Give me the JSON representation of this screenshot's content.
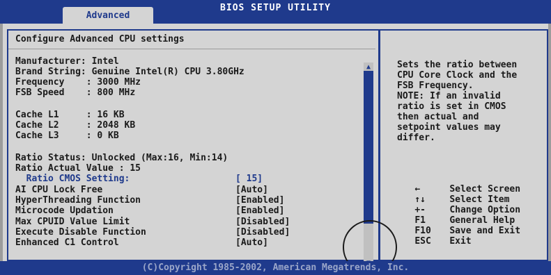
{
  "window": {
    "title": "BIOS SETUP UTILITY",
    "active_tab": "Advanced"
  },
  "main": {
    "heading": "Configure Advanced CPU settings",
    "info": [
      "Manufacturer: Intel",
      "Brand String: Genuine Intel(R) CPU 3.80GHz",
      "Frequency    : 3000 MHz",
      "FSB Speed    : 800 MHz",
      "",
      "Cache L1     : 16 KB",
      "Cache L2     : 2048 KB",
      "Cache L3     : 0 KB",
      "",
      "Ratio Status: Unlocked (Max:16, Min:14)",
      "Ratio Actual Value : 15"
    ],
    "settings": [
      {
        "label": "  Ratio CMOS Setting:",
        "value": "[ 15]"
      },
      {
        "label": "AI CPU Lock Free",
        "value": "[Auto]"
      },
      {
        "label": "HyperThreading Function",
        "value": "[Enabled]"
      },
      {
        "label": "Microcode Updation",
        "value": "[Enabled]"
      },
      {
        "label": "Max CPUID Value Limit",
        "value": "[Disabled]"
      },
      {
        "label": "Execute Disable Function",
        "value": "[Disabled]"
      },
      {
        "label": "Enhanced C1 Control",
        "value": "[Auto]"
      }
    ]
  },
  "help": {
    "text": "Sets the ratio between\nCPU Core Clock and the\nFSB Frequency.\nNOTE: If an invalid\nratio is set in CMOS\nthen actual and\nsetpoint values may\ndiffer."
  },
  "keys": [
    {
      "key": "←",
      "action": "Select Screen"
    },
    {
      "key": "↑↓",
      "action": "Select Item"
    },
    {
      "key": "+-",
      "action": "Change Option"
    },
    {
      "key": "F1",
      "action": "General Help"
    },
    {
      "key": "F10",
      "action": "Save and Exit"
    },
    {
      "key": "ESC",
      "action": "Exit"
    }
  ],
  "footer": "(C)Copyright 1985-2002, American Megatrends, Inc."
}
